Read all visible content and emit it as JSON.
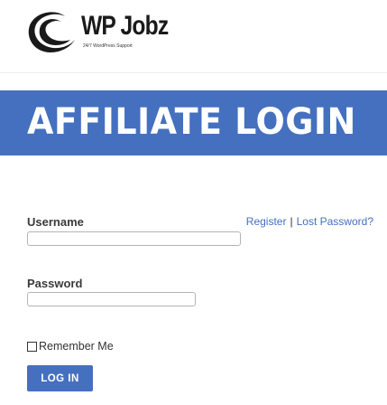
{
  "logo": {
    "name": "WP Jobz",
    "tagline": "24/7 WordPress Support",
    "icon": "crescent-swoosh-icon"
  },
  "banner": {
    "title": "AFFILIATE LOGIN",
    "color": "#4570bf"
  },
  "form": {
    "username_label": "Username",
    "username_value": "",
    "password_label": "Password",
    "password_value": "",
    "remember_label": "Remember Me",
    "remember_checked": false,
    "submit_label": "LOG IN"
  },
  "links": {
    "register": "Register",
    "separator": "|",
    "lost_password": "Lost Password?"
  },
  "colors": {
    "accent": "#4570bf",
    "text": "#3a3a3a"
  }
}
